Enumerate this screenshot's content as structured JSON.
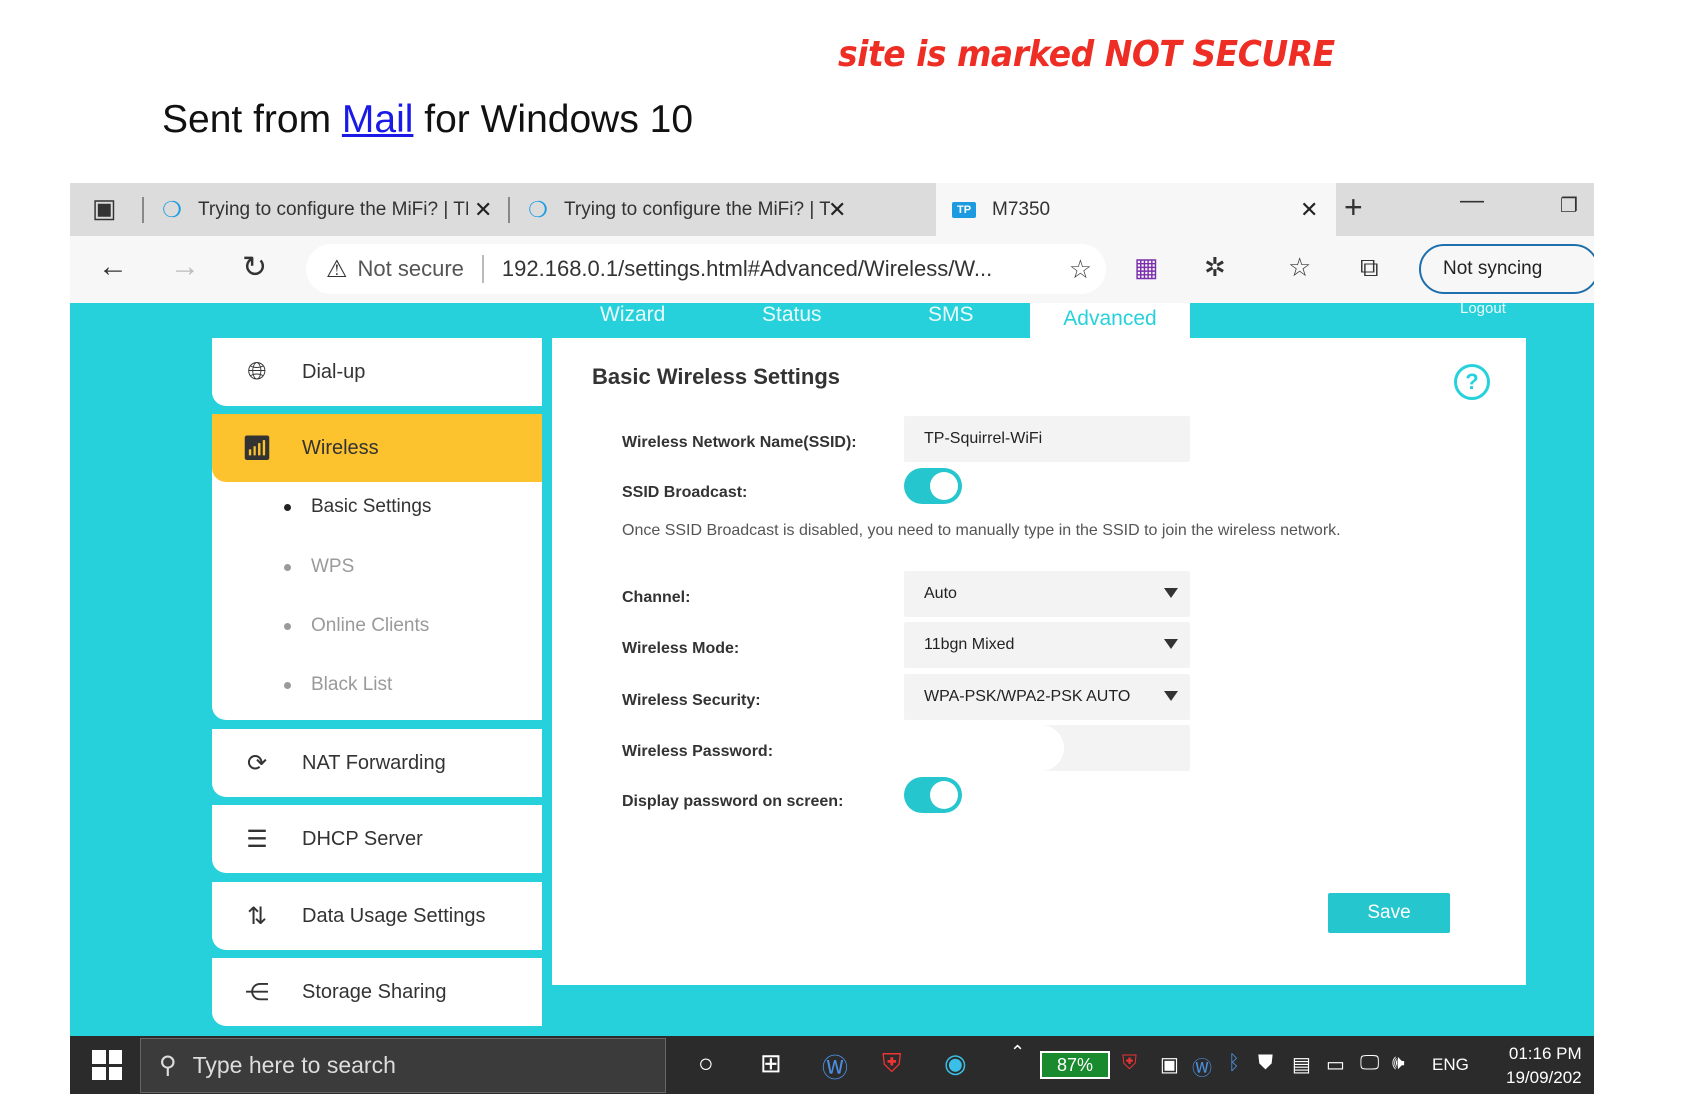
{
  "annotation": "site is marked NOT SECURE",
  "email": {
    "prefix": "Sent from ",
    "link": "Mail",
    "suffix": " for Windows 10"
  },
  "browser": {
    "tabs": [
      {
        "title": "Trying to configure the MiFi? | TP"
      },
      {
        "title": "Trying to configure the MiFi? | TP"
      },
      {
        "title": "M7350",
        "logo": "TP"
      }
    ],
    "new_tab": "+",
    "address": {
      "security": "Not secure",
      "url": "192.168.0.1/settings.html#Advanced/Wireless/W..."
    },
    "sync_label": "Not syncing"
  },
  "router": {
    "nav": [
      "Wizard",
      "Status",
      "SMS",
      "Advanced"
    ],
    "logout": "Logout",
    "sidebar": {
      "dialup": "Dial-up",
      "wireless": "Wireless",
      "subs": [
        "Basic Settings",
        "WPS",
        "Online Clients",
        "Black List"
      ],
      "nat": "NAT Forwarding",
      "dhcp": "DHCP Server",
      "data_usage": "Data Usage Settings",
      "storage": "Storage Sharing"
    },
    "panel": {
      "title": "Basic Wireless Settings",
      "help": "?",
      "ssid_label": "Wireless Network Name(SSID):",
      "ssid_value": "TP-Squirrel-WiFi",
      "broadcast_label": "SSID Broadcast:",
      "note": "Once SSID Broadcast is disabled, you need to manually type in the SSID to join the wireless network.",
      "channel_label": "Channel:",
      "channel_value": "Auto",
      "mode_label": "Wireless Mode:",
      "mode_value": "11bgn Mixed",
      "security_label": "Wireless Security:",
      "security_value": "WPA-PSK/WPA2-PSK AUTO",
      "password_label": "Wireless Password:",
      "display_label": "Display password on screen:",
      "save": "Save"
    }
  },
  "taskbar": {
    "search_placeholder": "Type here to search",
    "battery": "87%",
    "lang": "ENG",
    "time": "01:16 PM",
    "date": "19/09/202"
  }
}
